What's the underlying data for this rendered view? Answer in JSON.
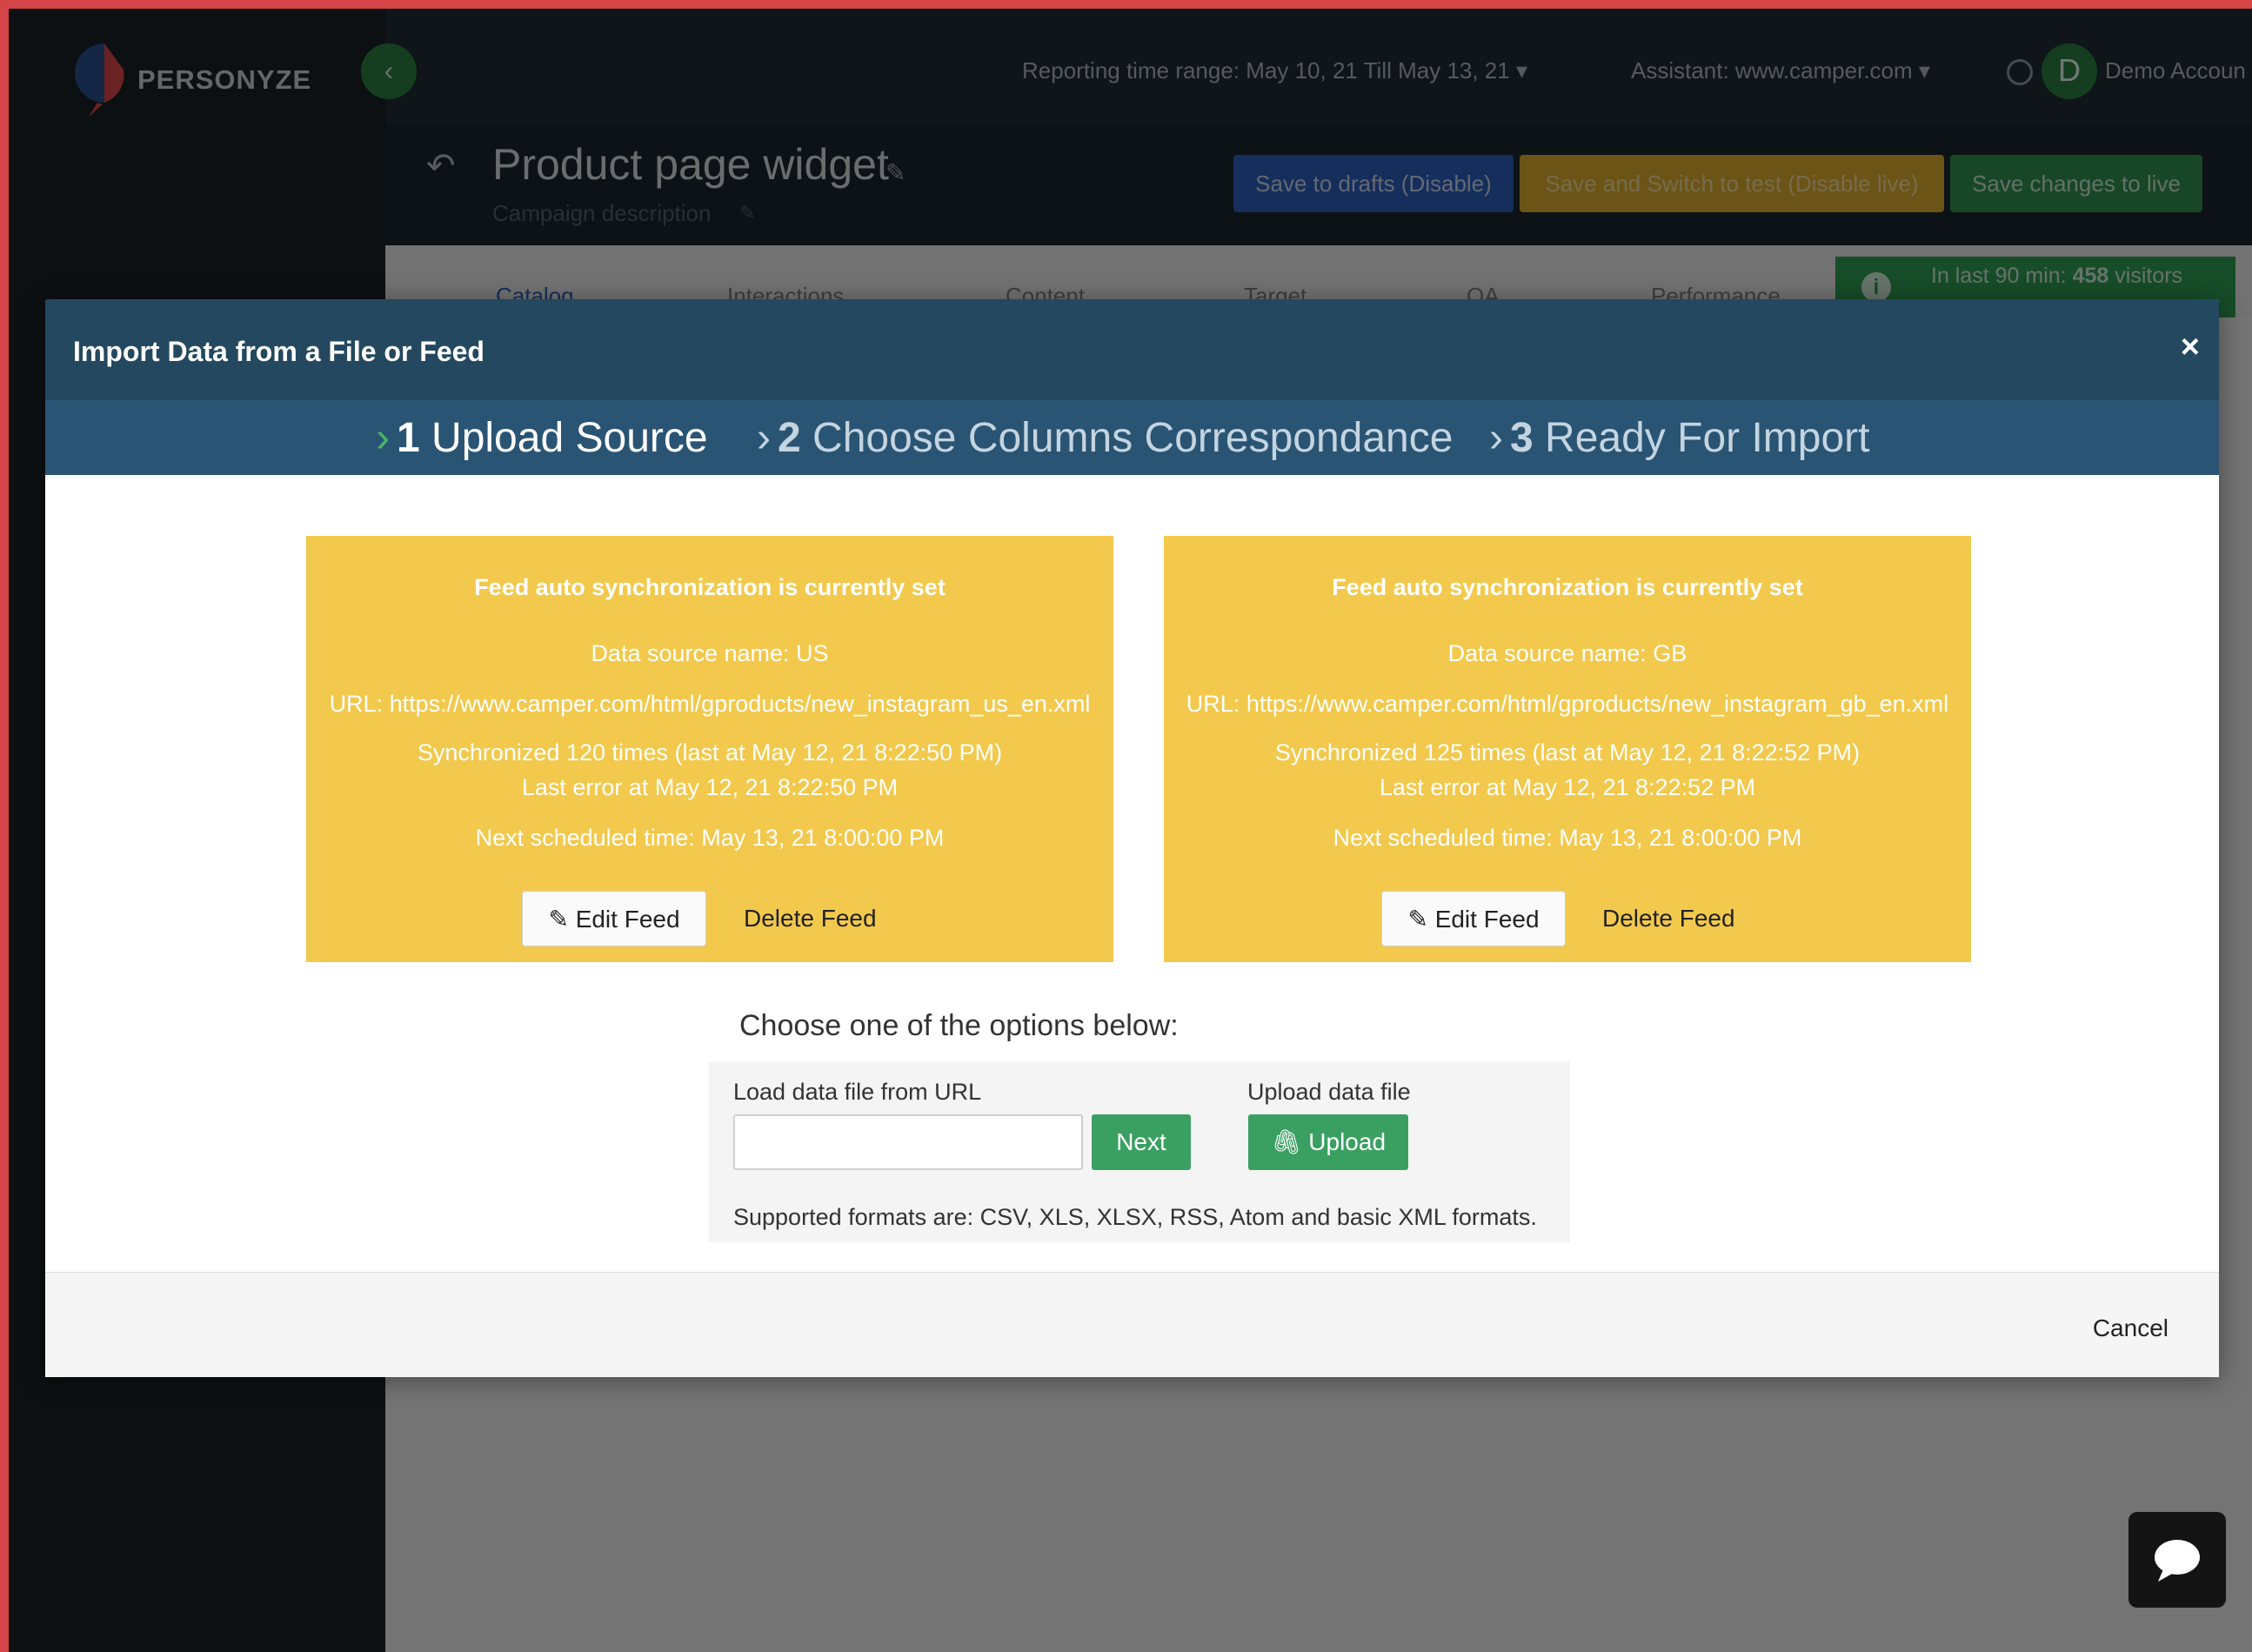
{
  "app": {
    "logo_text": "PERSONYZE",
    "reporting_range": "Reporting time range: May 10, 21 Till May 13, 21",
    "assistant": "Assistant: www.camper.com",
    "avatar_letter": "D",
    "account": "Demo Accoun",
    "page_title": "Product page widget",
    "campaign_description": "Campaign description",
    "buttons": {
      "save_drafts": "Save to drafts (Disable)",
      "save_test": "Save and Switch to test (Disable live)",
      "save_live": "Save changes to live"
    },
    "nav_tabs": [
      "Catalog",
      "Interactions",
      "Content",
      "Target",
      "QA",
      "Performance"
    ],
    "stats": {
      "label": "In last 90 min:",
      "value": "458",
      "unit": "visitors"
    }
  },
  "modal": {
    "title": "Import Data from a File or Feed",
    "close": "×",
    "steps": [
      {
        "num": "1",
        "label": "Upload Source"
      },
      {
        "num": "2",
        "label": "Choose Columns Correspondance"
      },
      {
        "num": "3",
        "label": "Ready For Import"
      }
    ],
    "feeds": [
      {
        "heading": "Feed auto synchronization is currently set",
        "name": "Data source name: US",
        "url": "URL: https://www.camper.com/html/gproducts/new_instagram_us_en.xml",
        "synced": "Synchronized 120 times (last at May 12, 21 8:22:50 PM)",
        "last_error": "Last error at May 12, 21 8:22:50 PM",
        "next": "Next scheduled time: May 13, 21 8:00:00 PM",
        "edit_label": "Edit Feed",
        "delete_label": "Delete Feed"
      },
      {
        "heading": "Feed auto synchronization is currently set",
        "name": "Data source name: GB",
        "url": "URL: https://www.camper.com/html/gproducts/new_instagram_gb_en.xml",
        "synced": "Synchronized 125 times (last at May 12, 21 8:22:52 PM)",
        "last_error": "Last error at May 12, 21 8:22:52 PM",
        "next": "Next scheduled time: May 13, 21 8:00:00 PM",
        "edit_label": "Edit Feed",
        "delete_label": "Delete Feed"
      }
    ],
    "choose_label": "Choose one of the options below:",
    "load_url_label": "Load data file from URL",
    "url_value": "",
    "next_label": "Next",
    "upload_label_text": "Upload data file",
    "upload_button": "Upload",
    "formats": "Supported formats are: CSV, XLS, XLSX, RSS, Atom and basic XML formats.",
    "cancel": "Cancel"
  },
  "colors": {
    "modal_header": "#23485f",
    "wizard_bar": "#2a5474",
    "feed_card": "#f2c94c",
    "green_button": "#3aa062",
    "check_chevron": "#4bb56a"
  }
}
